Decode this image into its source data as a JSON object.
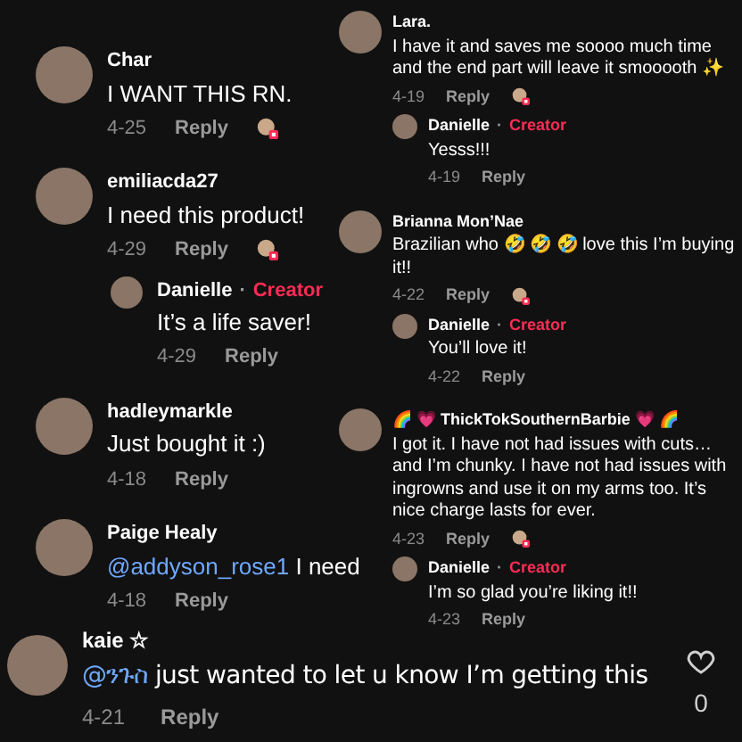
{
  "left_column": [
    {
      "author": "Char",
      "text": "I WANT THIS RN.",
      "date": "4-25",
      "reply_label": "Reply",
      "liked_by_creator": true
    },
    {
      "author": "emiliacda27",
      "text": "I need this product!",
      "date": "4-29",
      "reply_label": "Reply",
      "liked_by_creator": true,
      "replies": [
        {
          "author": "Danielle",
          "separator": "·",
          "badge": "Creator",
          "text": "It’s a life saver!",
          "date": "4-29",
          "reply_label": "Reply"
        }
      ]
    },
    {
      "author": "hadleymarkle",
      "text": "Just bought it :)",
      "date": "4-18",
      "reply_label": "Reply",
      "liked_by_creator": false
    },
    {
      "author": "Paige Healy",
      "mention": "@addyson_rose1",
      "text": " I need",
      "date": "4-18",
      "reply_label": "Reply",
      "liked_by_creator": false
    }
  ],
  "right_column": [
    {
      "author": "Lara.",
      "text": "I have it and saves me soooo much time and the end part will leave it smooooth ✨",
      "date": "4-19",
      "reply_label": "Reply",
      "liked_by_creator": true,
      "replies": [
        {
          "author": "Danielle",
          "separator": "·",
          "badge": "Creator",
          "text": "Yesss!!!",
          "date": "4-19",
          "reply_label": "Reply"
        }
      ]
    },
    {
      "author": "Brianna Mon’Nae",
      "text": "Brazilian who 🤣 🤣 🤣 love this I’m buying it!!",
      "date": "4-22",
      "reply_label": "Reply",
      "liked_by_creator": true,
      "replies": [
        {
          "author": "Danielle",
          "separator": "·",
          "badge": "Creator",
          "text": "You’ll love it!",
          "date": "4-22",
          "reply_label": "Reply"
        }
      ]
    },
    {
      "author": "🌈 💗 ThickTokSouthernBarbie 💗 🌈",
      "text": "I got it. I have not had issues with cuts… and I’m chunky. I have not had issues with ingrowns and use it on my arms too. It’s nice charge lasts for ever.",
      "date": "4-23",
      "reply_label": "Reply",
      "liked_by_creator": true,
      "replies": [
        {
          "author": "Danielle",
          "separator": "·",
          "badge": "Creator",
          "text": "I’m so glad you’re liking it!!",
          "date": "4-23",
          "reply_label": "Reply"
        }
      ]
    }
  ],
  "bottom_comment": {
    "author": "kaie ☆",
    "mention": "@ንጉስ",
    "text": " just wanted to let u know I’m getting this",
    "date": "4-21",
    "reply_label": "Reply",
    "like_count": "0",
    "liked": false
  }
}
